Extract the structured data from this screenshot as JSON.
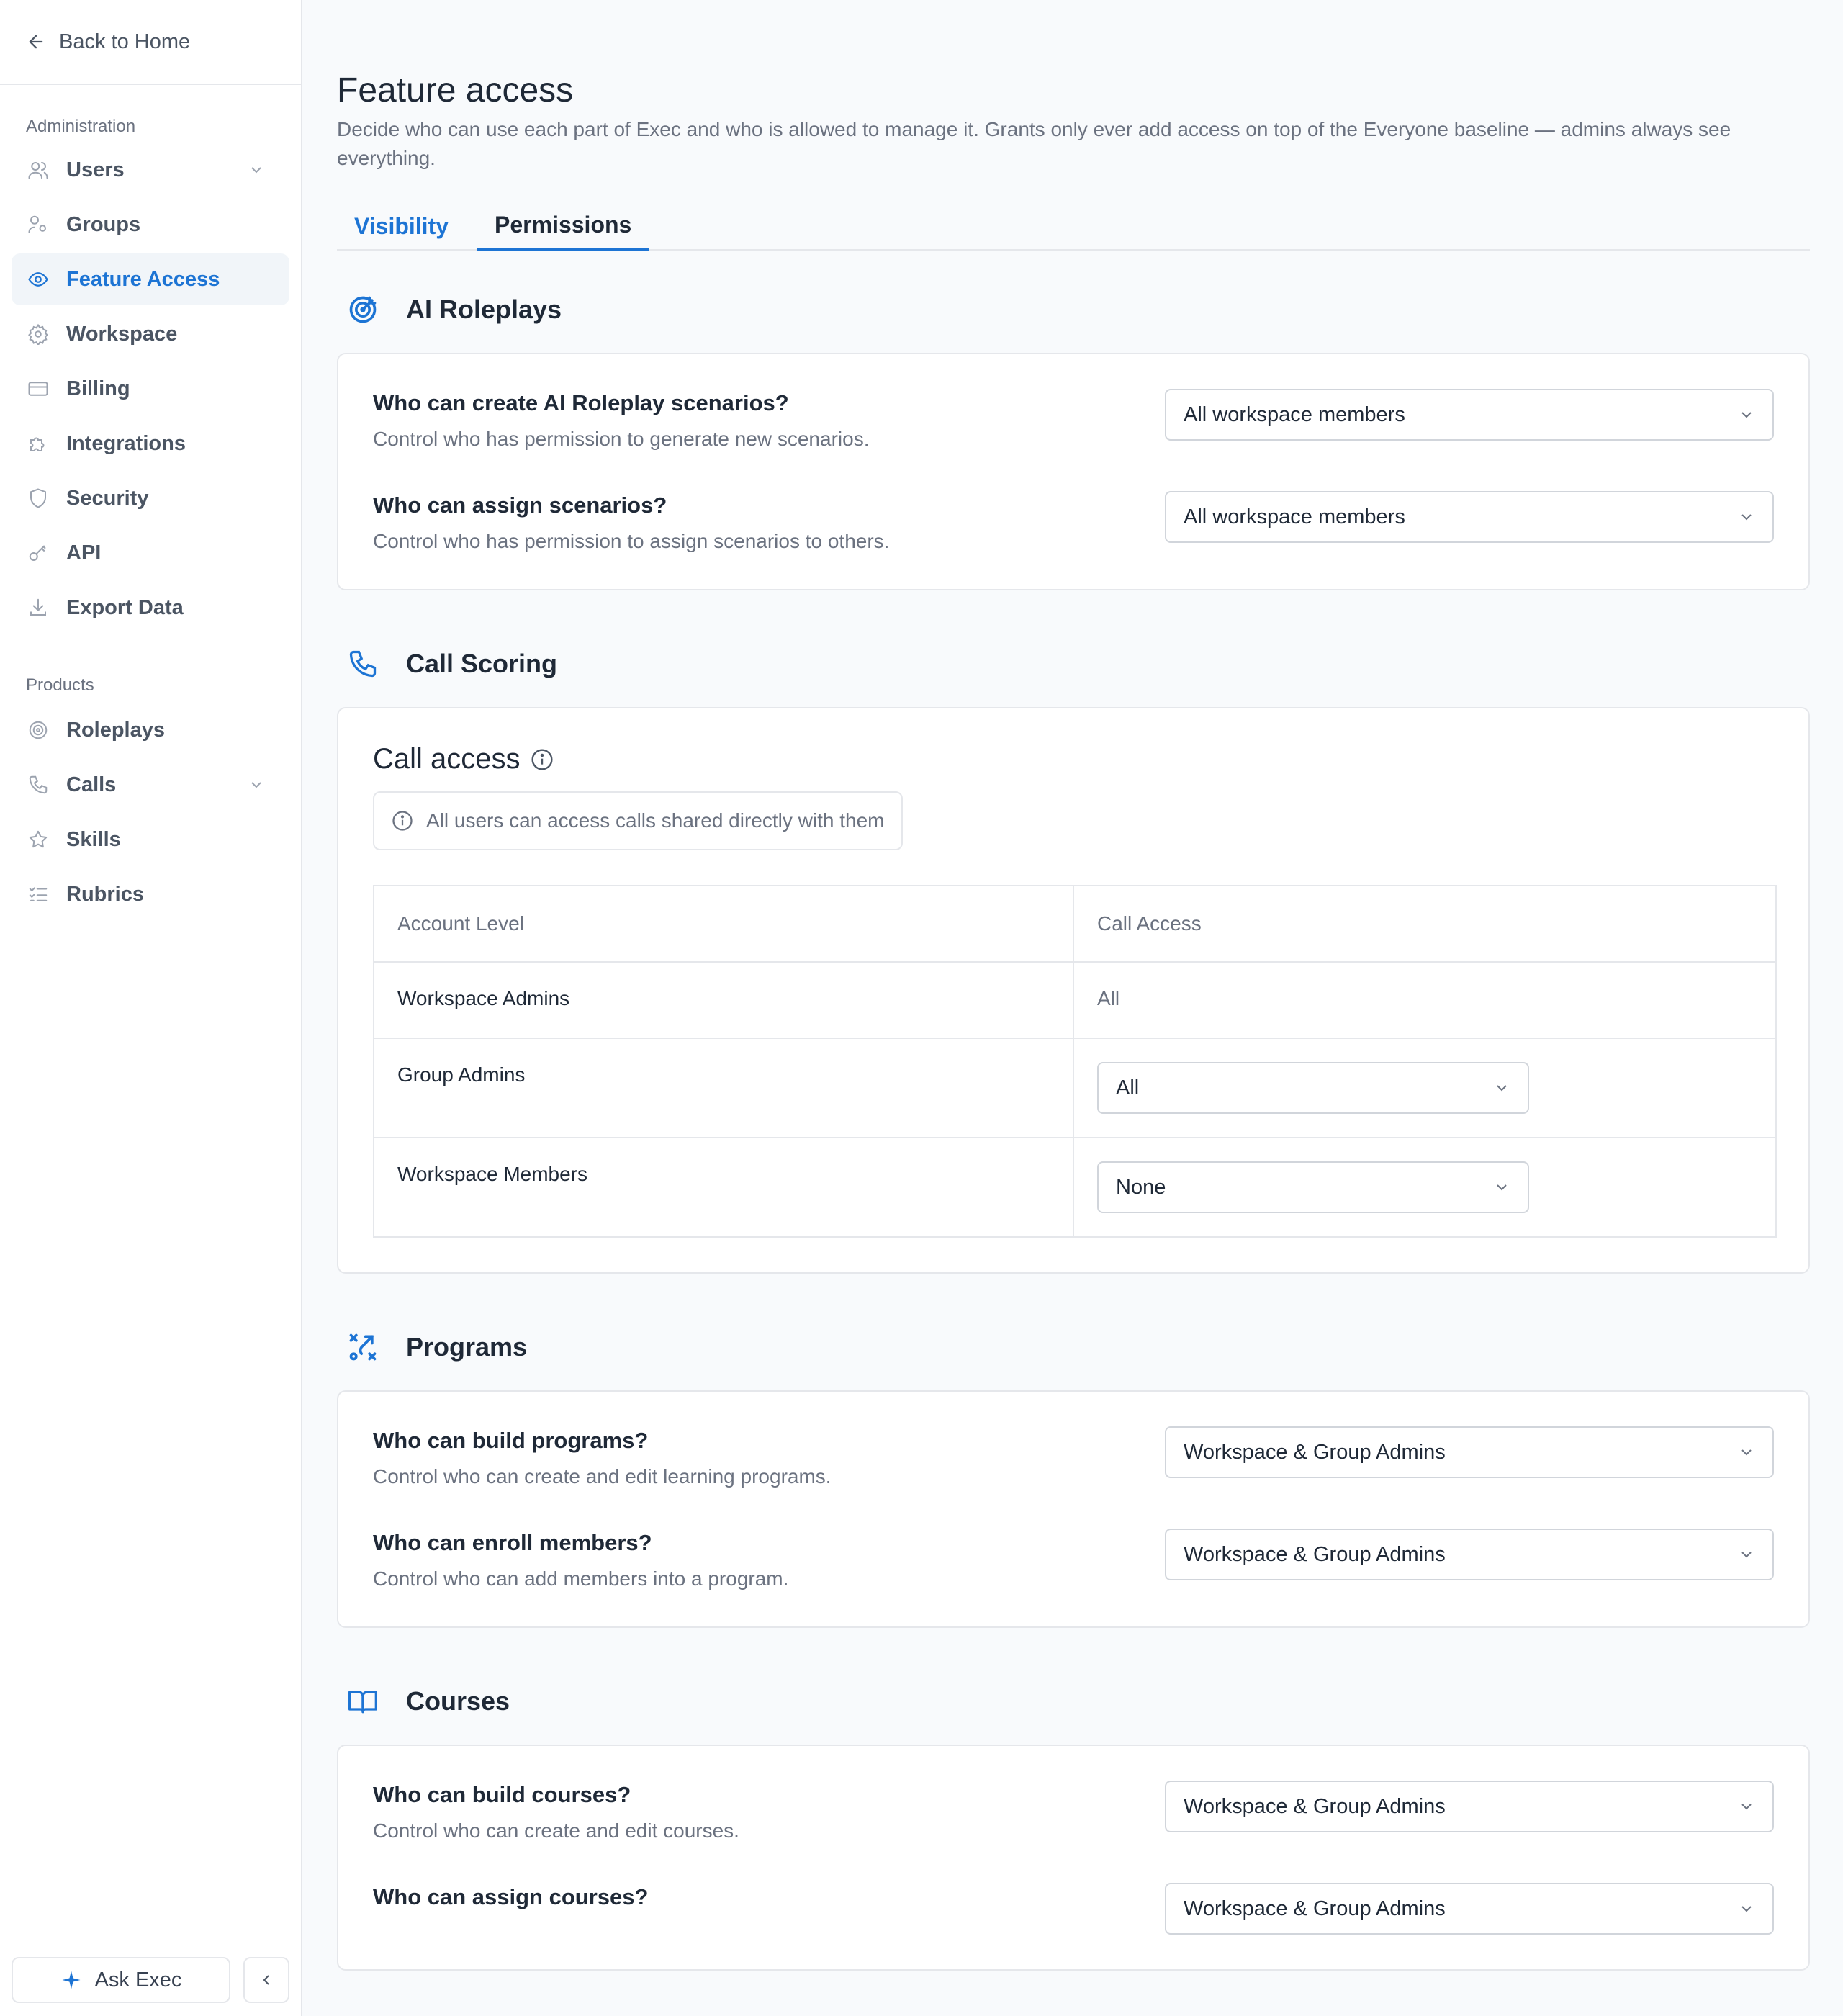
{
  "sidebar": {
    "back_label": "Back to Home",
    "admin_label": "Administration",
    "admin_items": [
      {
        "label": "Users",
        "icon": "users-icon",
        "has_chevron": true
      },
      {
        "label": "Groups",
        "icon": "groups-icon"
      },
      {
        "label": "Feature Access",
        "icon": "eye-icon",
        "active": true
      },
      {
        "label": "Workspace",
        "icon": "gear-icon"
      },
      {
        "label": "Billing",
        "icon": "credit-card-icon"
      },
      {
        "label": "Integrations",
        "icon": "puzzle-icon"
      },
      {
        "label": "Security",
        "icon": "shield-icon"
      },
      {
        "label": "API",
        "icon": "key-icon"
      },
      {
        "label": "Export Data",
        "icon": "download-icon"
      }
    ],
    "products_label": "Products",
    "product_items": [
      {
        "label": "Roleplays",
        "icon": "target-icon"
      },
      {
        "label": "Calls",
        "icon": "phone-icon",
        "has_chevron": true
      },
      {
        "label": "Skills",
        "icon": "star-icon"
      },
      {
        "label": "Rubrics",
        "icon": "checklist-icon"
      }
    ],
    "ask_label": "Ask Exec"
  },
  "page": {
    "title": "Feature access",
    "description": "Decide who can use each part of Exec and who is allowed to manage it. Grants only ever add access on top of the Everyone baseline — admins always see everything."
  },
  "tabs": {
    "visibility": "Visibility",
    "permissions": "Permissions",
    "active": "Permissions"
  },
  "sections": {
    "roleplays": {
      "title": "AI Roleplays",
      "rows": [
        {
          "question": "Who can create AI Roleplay scenarios?",
          "desc": "Control who has permission to generate new scenarios.",
          "value": "All workspace members"
        },
        {
          "question": "Who can assign scenarios?",
          "desc": "Control who has permission to assign scenarios to others.",
          "value": "All workspace members"
        }
      ]
    },
    "call_scoring": {
      "title": "Call Scoring",
      "card_title": "Call access",
      "info": "All users can access calls shared directly with them",
      "headers": [
        "Account Level",
        "Call Access"
      ],
      "rows": [
        {
          "level": "Workspace Admins",
          "access": "All"
        },
        {
          "level": "Group Admins",
          "access": "All"
        },
        {
          "level": "Workspace Members",
          "access": "None"
        }
      ]
    },
    "programs": {
      "title": "Programs",
      "rows": [
        {
          "question": "Who can build programs?",
          "desc": "Control who can create and edit learning programs.",
          "value": "Workspace & Group Admins"
        },
        {
          "question": "Who can enroll members?",
          "desc": "Control who can add members into a program.",
          "value": "Workspace & Group Admins"
        }
      ]
    },
    "courses": {
      "title": "Courses",
      "rows": [
        {
          "question": "Who can build courses?",
          "desc": "Control who can create and edit courses.",
          "value": "Workspace & Group Admins"
        },
        {
          "question": "Who can assign courses?",
          "desc": "",
          "value": "Workspace & Group Admins"
        }
      ]
    }
  },
  "colors": {
    "accent": "#1d74d4",
    "text": "#1f2937",
    "muted": "#6b7280",
    "border": "#e5e7eb",
    "background": "#f8fafc"
  }
}
